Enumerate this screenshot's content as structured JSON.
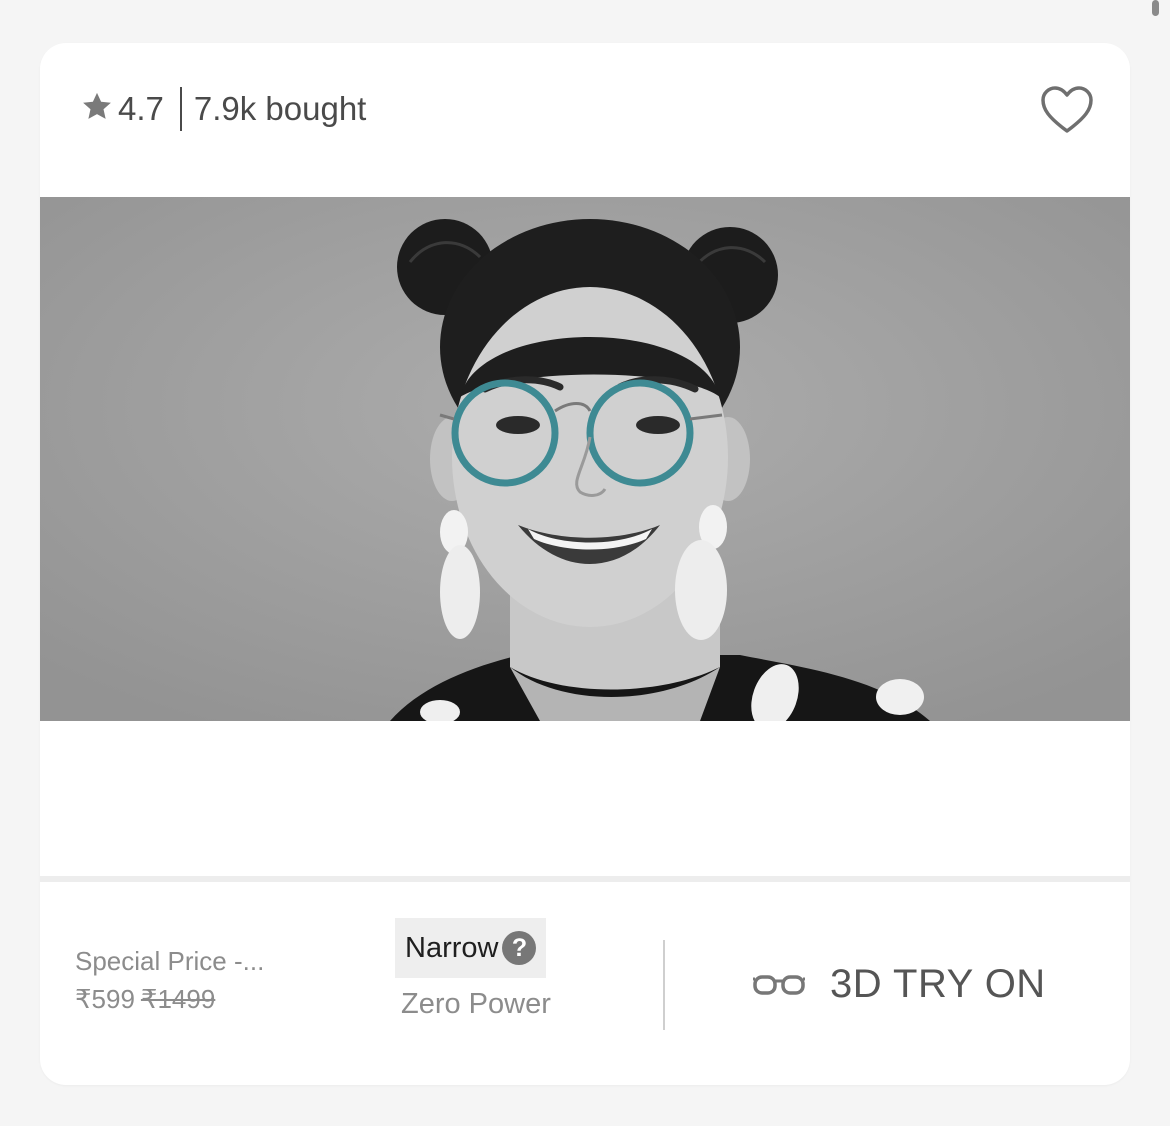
{
  "card": {
    "rating": "4.7",
    "bought": "7.9k bought",
    "price": {
      "label": "Special Price -...",
      "current": "₹599",
      "original": "₹1499"
    },
    "fit": {
      "label": "Narrow",
      "help": "?"
    },
    "power": "Zero Power",
    "try_on": "3D TRY ON"
  },
  "icons": {
    "rating": "star-icon",
    "wishlist": "heart-outline-icon",
    "fit_help": "question-circle-icon",
    "try_on": "glasses-icon"
  },
  "colors": {
    "card_bg": "#ffffff",
    "page_bg": "#f5f5f5",
    "text_dark": "#4a4a4a",
    "text_muted": "#8c8c8c",
    "chip_bg": "#eeeeee",
    "glasses_frame": "#3e8a93"
  }
}
